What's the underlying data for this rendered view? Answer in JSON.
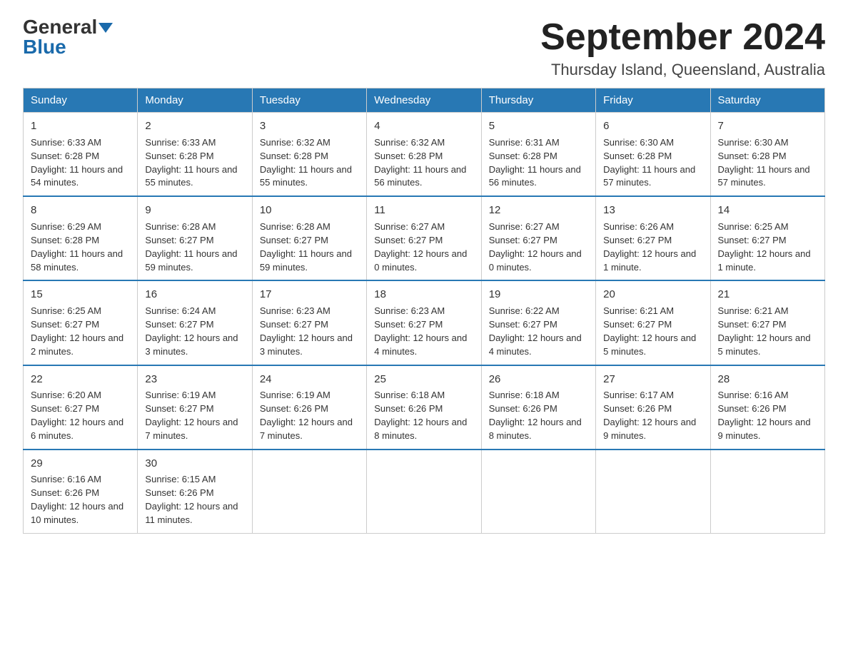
{
  "logo": {
    "general": "General",
    "blue": "Blue"
  },
  "title": "September 2024",
  "subtitle": "Thursday Island, Queensland, Australia",
  "weekdays": [
    "Sunday",
    "Monday",
    "Tuesday",
    "Wednesday",
    "Thursday",
    "Friday",
    "Saturday"
  ],
  "weeks": [
    [
      {
        "day": "1",
        "sunrise": "6:33 AM",
        "sunset": "6:28 PM",
        "daylight": "11 hours and 54 minutes."
      },
      {
        "day": "2",
        "sunrise": "6:33 AM",
        "sunset": "6:28 PM",
        "daylight": "11 hours and 55 minutes."
      },
      {
        "day": "3",
        "sunrise": "6:32 AM",
        "sunset": "6:28 PM",
        "daylight": "11 hours and 55 minutes."
      },
      {
        "day": "4",
        "sunrise": "6:32 AM",
        "sunset": "6:28 PM",
        "daylight": "11 hours and 56 minutes."
      },
      {
        "day": "5",
        "sunrise": "6:31 AM",
        "sunset": "6:28 PM",
        "daylight": "11 hours and 56 minutes."
      },
      {
        "day": "6",
        "sunrise": "6:30 AM",
        "sunset": "6:28 PM",
        "daylight": "11 hours and 57 minutes."
      },
      {
        "day": "7",
        "sunrise": "6:30 AM",
        "sunset": "6:28 PM",
        "daylight": "11 hours and 57 minutes."
      }
    ],
    [
      {
        "day": "8",
        "sunrise": "6:29 AM",
        "sunset": "6:28 PM",
        "daylight": "11 hours and 58 minutes."
      },
      {
        "day": "9",
        "sunrise": "6:28 AM",
        "sunset": "6:27 PM",
        "daylight": "11 hours and 59 minutes."
      },
      {
        "day": "10",
        "sunrise": "6:28 AM",
        "sunset": "6:27 PM",
        "daylight": "11 hours and 59 minutes."
      },
      {
        "day": "11",
        "sunrise": "6:27 AM",
        "sunset": "6:27 PM",
        "daylight": "12 hours and 0 minutes."
      },
      {
        "day": "12",
        "sunrise": "6:27 AM",
        "sunset": "6:27 PM",
        "daylight": "12 hours and 0 minutes."
      },
      {
        "day": "13",
        "sunrise": "6:26 AM",
        "sunset": "6:27 PM",
        "daylight": "12 hours and 1 minute."
      },
      {
        "day": "14",
        "sunrise": "6:25 AM",
        "sunset": "6:27 PM",
        "daylight": "12 hours and 1 minute."
      }
    ],
    [
      {
        "day": "15",
        "sunrise": "6:25 AM",
        "sunset": "6:27 PM",
        "daylight": "12 hours and 2 minutes."
      },
      {
        "day": "16",
        "sunrise": "6:24 AM",
        "sunset": "6:27 PM",
        "daylight": "12 hours and 3 minutes."
      },
      {
        "day": "17",
        "sunrise": "6:23 AM",
        "sunset": "6:27 PM",
        "daylight": "12 hours and 3 minutes."
      },
      {
        "day": "18",
        "sunrise": "6:23 AM",
        "sunset": "6:27 PM",
        "daylight": "12 hours and 4 minutes."
      },
      {
        "day": "19",
        "sunrise": "6:22 AM",
        "sunset": "6:27 PM",
        "daylight": "12 hours and 4 minutes."
      },
      {
        "day": "20",
        "sunrise": "6:21 AM",
        "sunset": "6:27 PM",
        "daylight": "12 hours and 5 minutes."
      },
      {
        "day": "21",
        "sunrise": "6:21 AM",
        "sunset": "6:27 PM",
        "daylight": "12 hours and 5 minutes."
      }
    ],
    [
      {
        "day": "22",
        "sunrise": "6:20 AM",
        "sunset": "6:27 PM",
        "daylight": "12 hours and 6 minutes."
      },
      {
        "day": "23",
        "sunrise": "6:19 AM",
        "sunset": "6:27 PM",
        "daylight": "12 hours and 7 minutes."
      },
      {
        "day": "24",
        "sunrise": "6:19 AM",
        "sunset": "6:26 PM",
        "daylight": "12 hours and 7 minutes."
      },
      {
        "day": "25",
        "sunrise": "6:18 AM",
        "sunset": "6:26 PM",
        "daylight": "12 hours and 8 minutes."
      },
      {
        "day": "26",
        "sunrise": "6:18 AM",
        "sunset": "6:26 PM",
        "daylight": "12 hours and 8 minutes."
      },
      {
        "day": "27",
        "sunrise": "6:17 AM",
        "sunset": "6:26 PM",
        "daylight": "12 hours and 9 minutes."
      },
      {
        "day": "28",
        "sunrise": "6:16 AM",
        "sunset": "6:26 PM",
        "daylight": "12 hours and 9 minutes."
      }
    ],
    [
      {
        "day": "29",
        "sunrise": "6:16 AM",
        "sunset": "6:26 PM",
        "daylight": "12 hours and 10 minutes."
      },
      {
        "day": "30",
        "sunrise": "6:15 AM",
        "sunset": "6:26 PM",
        "daylight": "12 hours and 11 minutes."
      },
      null,
      null,
      null,
      null,
      null
    ]
  ]
}
